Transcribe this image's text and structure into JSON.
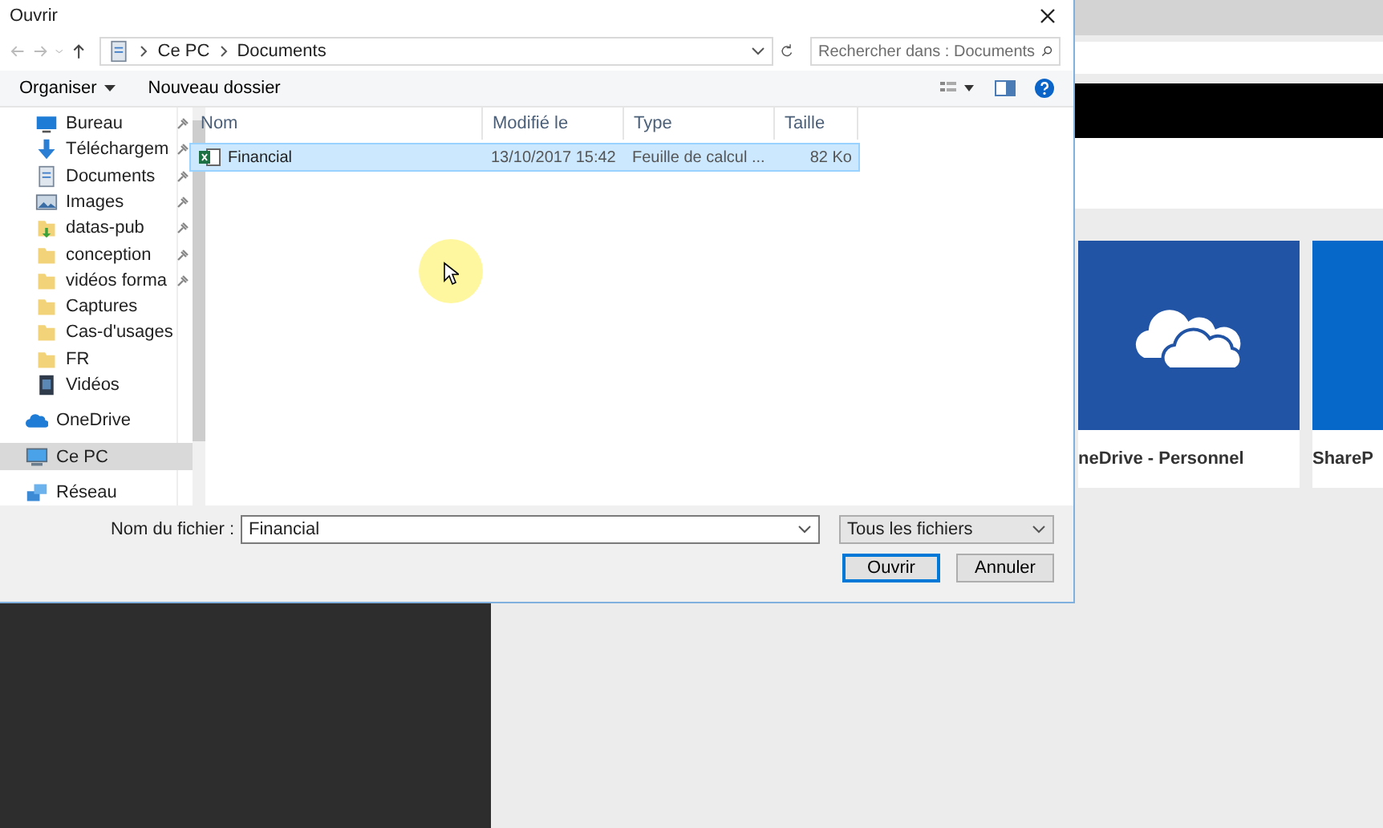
{
  "window": {
    "title": "Ouvrir"
  },
  "address": {
    "crumbs": [
      "Ce PC",
      "Documents"
    ]
  },
  "search": {
    "placeholder": "Rechercher dans : Documents"
  },
  "toolbar": {
    "organize": "Organiser",
    "new_folder": "Nouveau dossier"
  },
  "sidebar": {
    "pinned_items": [
      {
        "label": "Bureau",
        "kind": "desktop",
        "pinned": true,
        "selected": false
      },
      {
        "label": "Téléchargem",
        "kind": "download",
        "pinned": true,
        "selected": false
      },
      {
        "label": "Documents",
        "kind": "document",
        "pinned": true,
        "selected": false
      },
      {
        "label": "Images",
        "kind": "images",
        "pinned": true,
        "selected": false
      },
      {
        "label": "datas-pub",
        "kind": "folder-green",
        "pinned": true,
        "selected": false
      },
      {
        "label": "conception",
        "kind": "folder",
        "pinned": true,
        "selected": false
      },
      {
        "label": "vidéos forma",
        "kind": "folder",
        "pinned": true,
        "selected": false
      },
      {
        "label": "Captures",
        "kind": "folder",
        "pinned": false,
        "selected": false
      },
      {
        "label": "Cas-d'usages",
        "kind": "folder",
        "pinned": false,
        "selected": false
      },
      {
        "label": "FR",
        "kind": "folder",
        "pinned": false,
        "selected": false
      },
      {
        "label": "Vidéos",
        "kind": "video",
        "pinned": false,
        "selected": false
      }
    ],
    "items": [
      {
        "label": "OneDrive",
        "kind": "cloud",
        "selected": false
      },
      {
        "label": "Ce PC",
        "kind": "pc",
        "selected": true
      },
      {
        "label": "Réseau",
        "kind": "network",
        "selected": false
      }
    ]
  },
  "table": {
    "columns": [
      "Nom",
      "Modifié le",
      "Type",
      "Taille"
    ],
    "rows": [
      {
        "name": "Financial",
        "modified": "13/10/2017 15:42",
        "type": "Feuille de calcul ...",
        "size": "82 Ko",
        "selected": true
      }
    ]
  },
  "file_name": {
    "label": "Nom du fichier :",
    "value": "Financial"
  },
  "filter": {
    "value": "Tous les fichiers"
  },
  "buttons": [
    {
      "label": "Ouvrir",
      "kind": "default"
    },
    {
      "label": "Annuler",
      "kind": "normal"
    }
  ],
  "background": {
    "tiles": [
      {
        "label": "neDrive - Personnel",
        "kind": "cloud"
      },
      {
        "label": "ShareP",
        "kind": "plain"
      }
    ]
  }
}
